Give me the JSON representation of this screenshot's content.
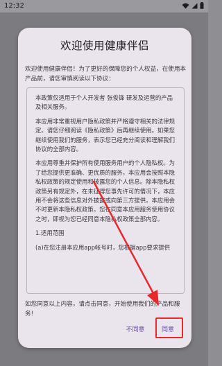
{
  "status_bar": {
    "time": "12:32"
  },
  "dialog": {
    "title": "欢迎使用健康伴侣",
    "intro": "欢迎使用健康伴侣！为了更好的保障您的个人权益，在使用本产品前，请您审慎阅读以下协议：",
    "policy_paragraphs": [
      "本政策仅适用于个人开发者 张俊锋 研发及运营的产品及相关服务。",
      "本应用非常重视用户隐私政策并严格遵守相关的法律规定。请您仔细阅读《隐私政策》后再继续使用。如果您继续使用我们的服务，表示您已经充分阅读和理解我们协议的全部内容。",
      "本应用尊重并保护所有使用服务用户的个人隐私权。为了给您提供更准确、更优质的服务，本应用会按照本隐私权政策的规定使用和披露您的个人信息。除本隐私权政策另有规定外，在未征得您事先许可的情况下，本应用不会将这些信息对外披露或向第三方提供。本应用会不时更新本隐私权政策。您在同意本应用服务使用协议之时，即视为您已经同意本隐私权政策全部内容。",
      "1.适用范围",
      "(a)在您注册本应用app帐号时，您根据app要求提供"
    ],
    "outro": "如您同意以上内容，请点击同意，开始使用我们的产品和服务!",
    "disagree_label": "不同意",
    "agree_label": "同意"
  },
  "annotation": {
    "highlight_color": "#e8282c"
  }
}
